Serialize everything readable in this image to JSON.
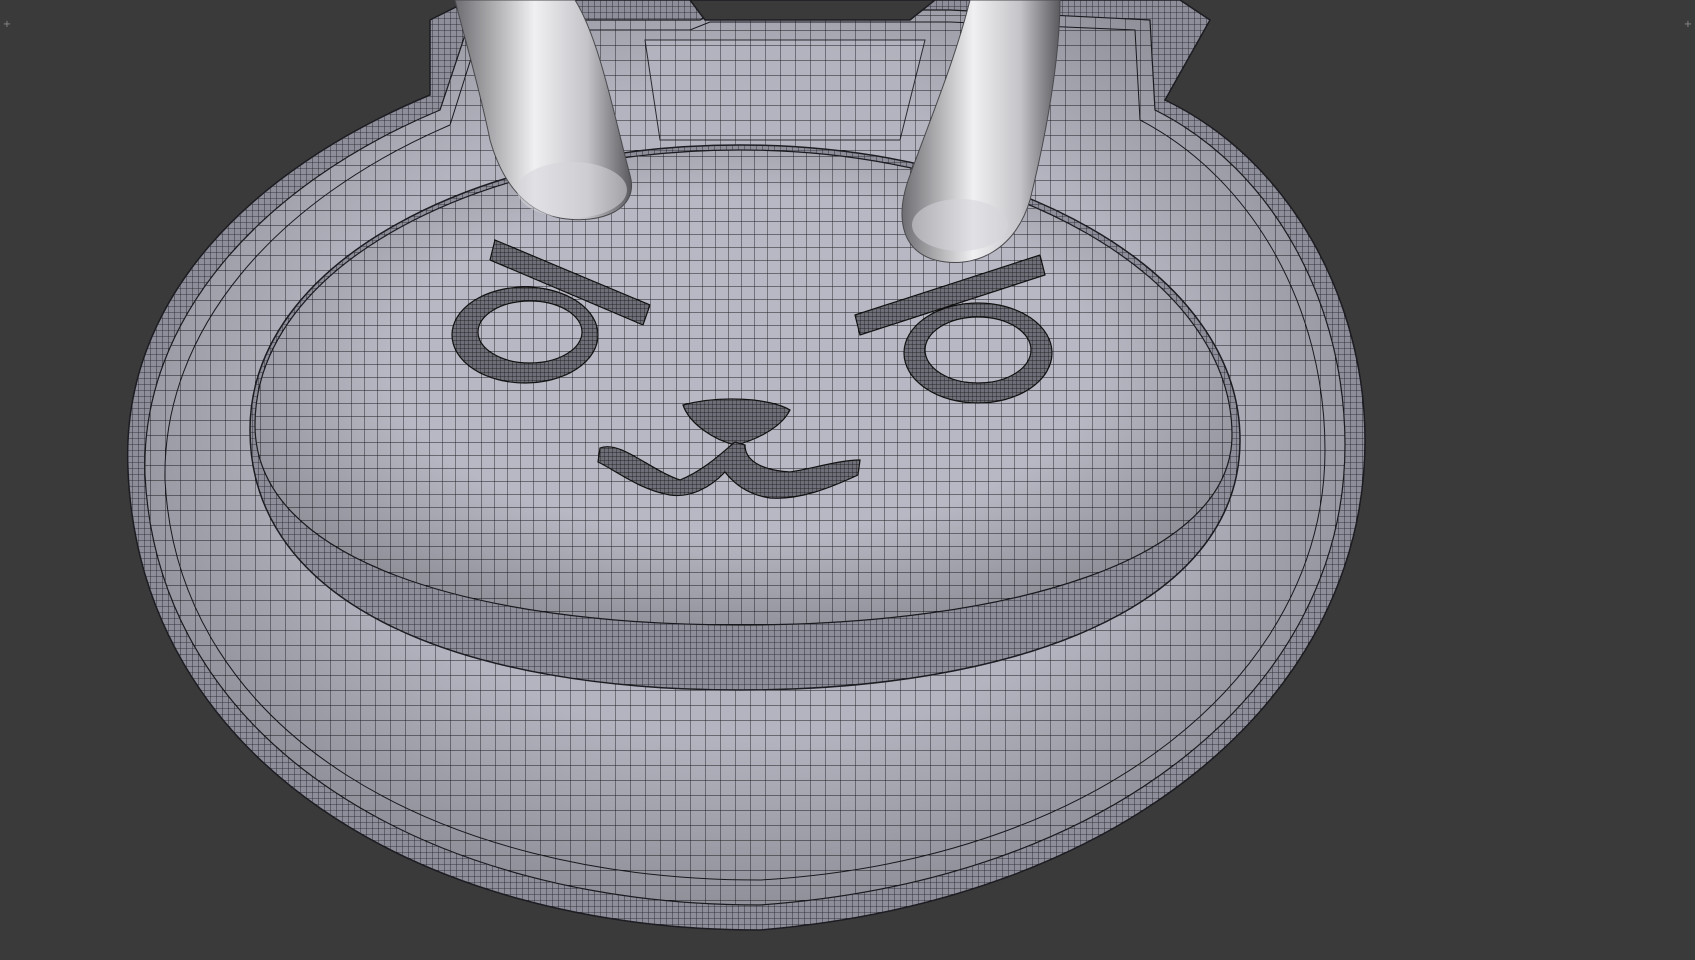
{
  "viewport": {
    "background": "#3a3a3a",
    "mesh_fill": "#b4b4c0",
    "mesh_shade": "#9c9caa",
    "wire_color": "#1c1c22",
    "ear_metal_light": "#f0f0f2",
    "ear_metal_dark": "#6e6e72",
    "corner_widget_icon": "plus-icon"
  },
  "corner_widgets": {
    "left_glyph": "+",
    "right_glyph": "+"
  }
}
